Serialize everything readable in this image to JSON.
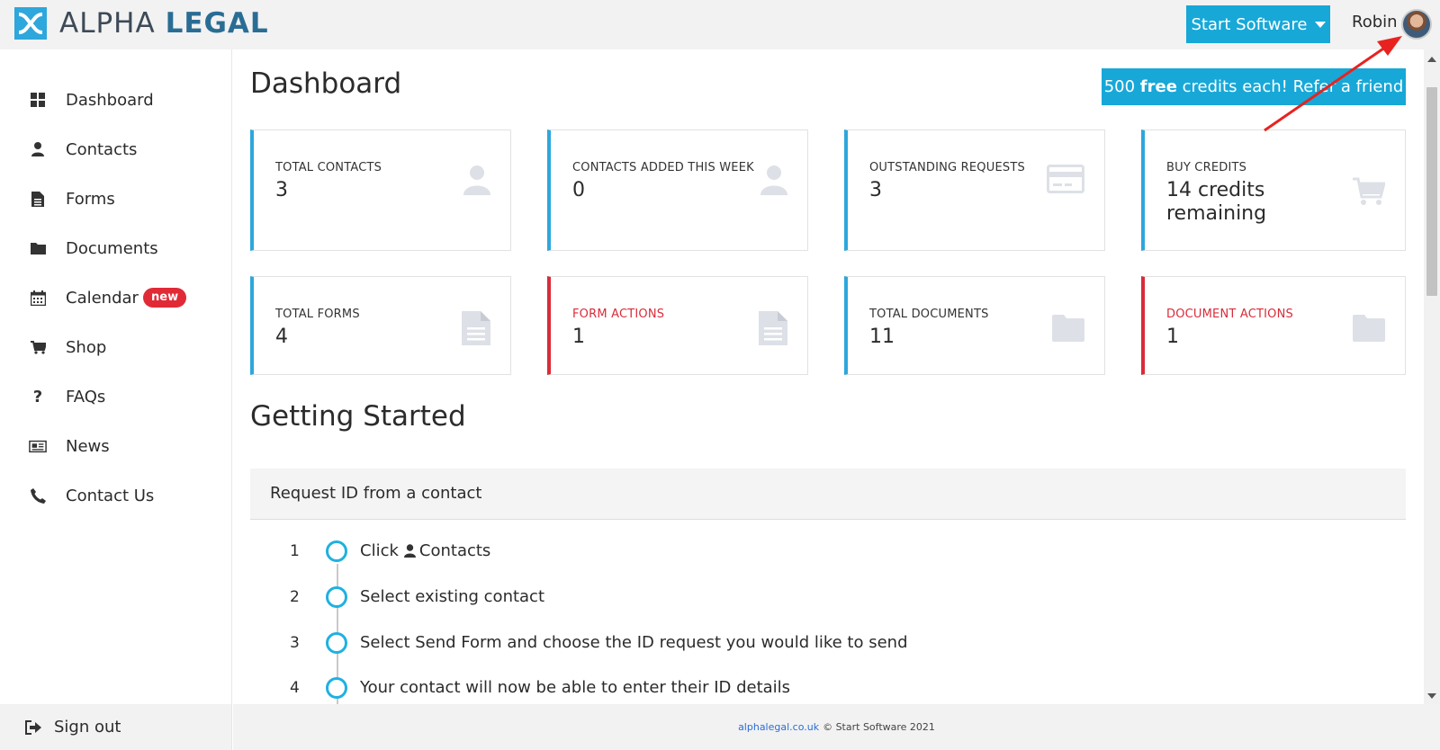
{
  "header": {
    "brand_light": "ALPHA",
    "brand_bold": "LEGAL",
    "start_button_label": "Start Software",
    "username": "Robin"
  },
  "sidebar": {
    "items": [
      {
        "label": "Dashboard",
        "icon": "dashboard-icon"
      },
      {
        "label": "Contacts",
        "icon": "user-icon"
      },
      {
        "label": "Forms",
        "icon": "form-icon"
      },
      {
        "label": "Documents",
        "icon": "folder-icon"
      },
      {
        "label": "Calendar",
        "icon": "calendar-icon",
        "badge": "new"
      },
      {
        "label": "Shop",
        "icon": "cart-icon"
      },
      {
        "label": "FAQs",
        "icon": "question-icon"
      },
      {
        "label": "News",
        "icon": "newspaper-icon"
      },
      {
        "label": "Contact Us",
        "icon": "phone-icon"
      }
    ],
    "signout_label": "Sign out"
  },
  "main": {
    "title": "Dashboard",
    "refer": {
      "prefix": "500",
      "bold": "free",
      "suffix": "credits each! Refer a friend"
    },
    "cards": [
      {
        "label": "TOTAL CONTACTS",
        "value": "3",
        "accent": "#2ea7dc",
        "icon": "user-icon"
      },
      {
        "label": "CONTACTS ADDED THIS WEEK",
        "value": "0",
        "accent": "#2ea7dc",
        "icon": "user-icon"
      },
      {
        "label": "OUTSTANDING REQUESTS",
        "value": "3",
        "accent": "#2ea7dc",
        "icon": "credit-card-icon"
      },
      {
        "label": "BUY CREDITS",
        "value": "14 credits remaining",
        "accent": "#2ea7dc",
        "icon": "cart-icon"
      },
      {
        "label": "TOTAL FORMS",
        "value": "4",
        "accent": "#2ea7dc",
        "icon": "document-icon"
      },
      {
        "label": "FORM ACTIONS",
        "value": "1",
        "accent": "#d92c3a",
        "icon": "document-icon"
      },
      {
        "label": "TOTAL DOCUMENTS",
        "value": "11",
        "accent": "#2ea7dc",
        "icon": "folder-icon"
      },
      {
        "label": "DOCUMENT ACTIONS",
        "value": "1",
        "accent": "#d92c3a",
        "icon": "folder-icon"
      }
    ],
    "getting_started": {
      "title": "Getting Started",
      "panel_title": "Request ID from a contact",
      "steps": [
        {
          "num": "1",
          "text_before": "Click",
          "text_after": "Contacts"
        },
        {
          "num": "2",
          "text": "Select existing contact"
        },
        {
          "num": "3",
          "text": "Select Send Form and choose the ID request you would like to send"
        },
        {
          "num": "4",
          "text": "Your contact will now be able to enter their ID details"
        }
      ]
    }
  },
  "footer": {
    "link": "alphalegal.co.uk",
    "text": "© Start Software 2021"
  },
  "colors": {
    "accent_blue": "#17a8d8",
    "card_blue": "#2ea7dc",
    "card_red": "#d92c3a",
    "badge_red": "#e02b36",
    "annotation_red": "#e8231f"
  }
}
